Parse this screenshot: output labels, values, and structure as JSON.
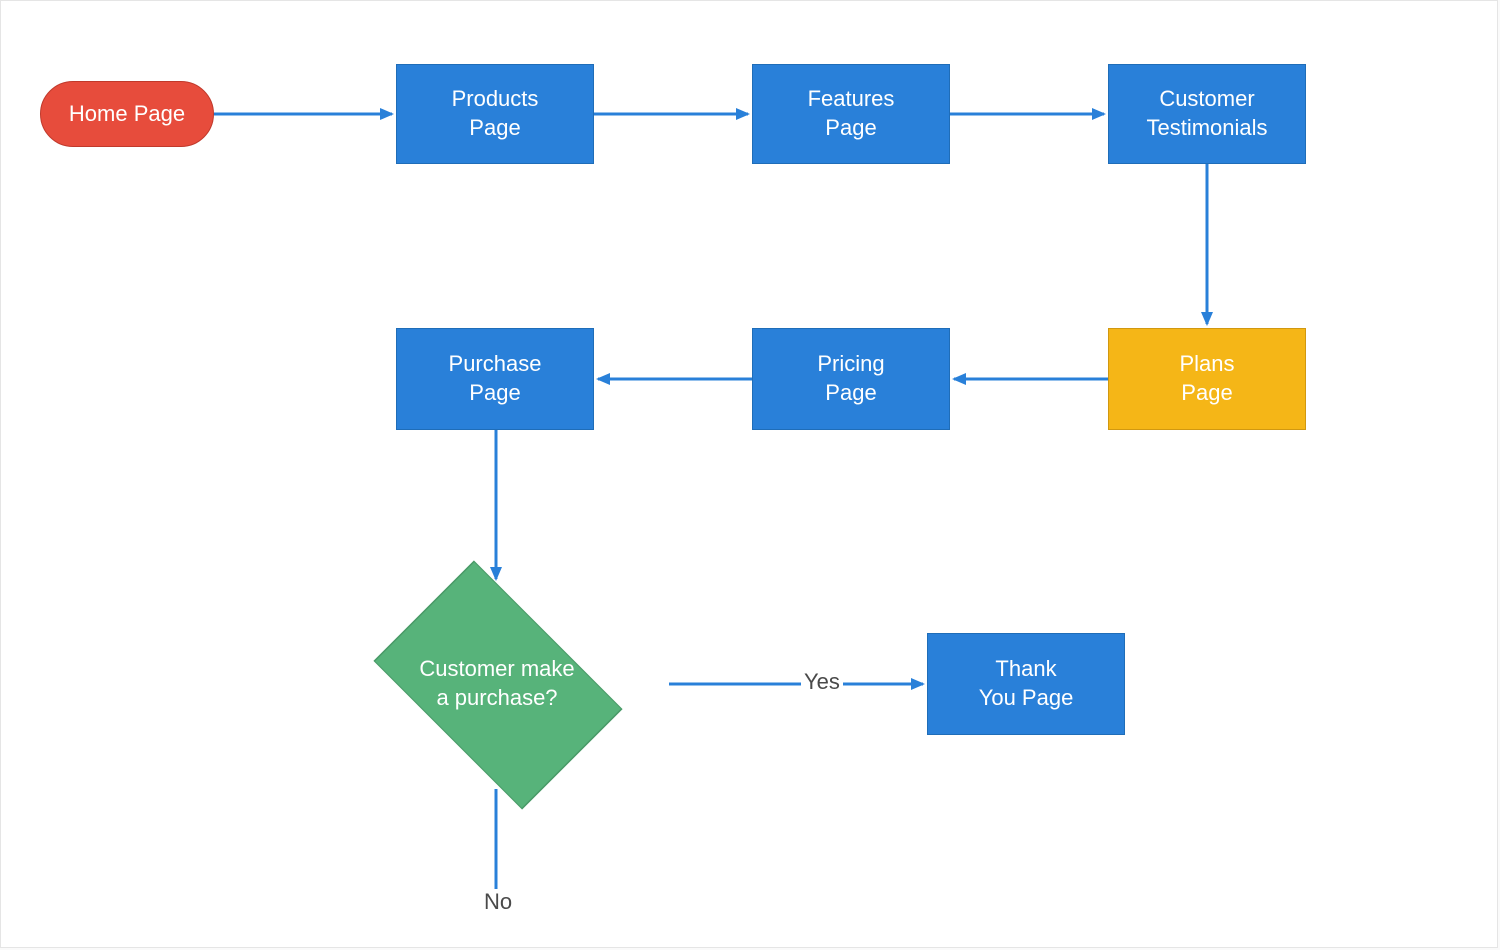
{
  "colors": {
    "terminator": "#e74c3c",
    "process": "#2980d9",
    "highlight": "#f5b617",
    "decision": "#57b37a",
    "arrow": "#2980d9",
    "labelText": "#4a4a4a"
  },
  "nodes": {
    "home": {
      "type": "terminator",
      "label": "Home Page"
    },
    "products": {
      "type": "process",
      "label": "Products\nPage"
    },
    "features": {
      "type": "process",
      "label": "Features\nPage"
    },
    "testimonials": {
      "type": "process",
      "label": "Customer\nTestimonials"
    },
    "plans": {
      "type": "process-highlight",
      "label": "Plans\nPage"
    },
    "pricing": {
      "type": "process",
      "label": "Pricing\nPage"
    },
    "purchase": {
      "type": "process",
      "label": "Purchase\nPage"
    },
    "decision": {
      "type": "decision",
      "label": "Customer make\na purchase?"
    },
    "thankyou": {
      "type": "process",
      "label": "Thank\nYou  Page"
    }
  },
  "edges": [
    {
      "from": "home",
      "to": "products"
    },
    {
      "from": "products",
      "to": "features"
    },
    {
      "from": "features",
      "to": "testimonials"
    },
    {
      "from": "testimonials",
      "to": "plans"
    },
    {
      "from": "plans",
      "to": "pricing"
    },
    {
      "from": "pricing",
      "to": "purchase"
    },
    {
      "from": "purchase",
      "to": "decision"
    },
    {
      "from": "decision",
      "to": "thankyou",
      "label": "Yes"
    },
    {
      "from": "decision",
      "to": null,
      "label": "No"
    }
  ],
  "edgeLabels": {
    "yes": "Yes",
    "no": "No"
  }
}
